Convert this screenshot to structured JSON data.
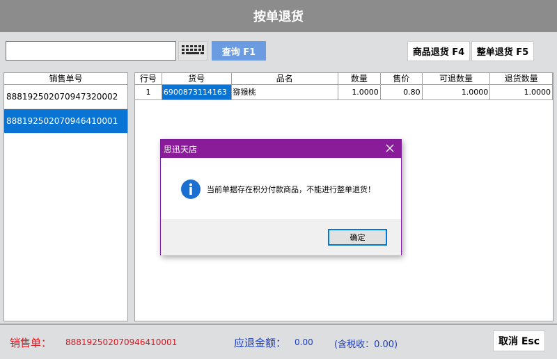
{
  "title": "按单退货",
  "search": {
    "value": "",
    "query_label": "查询 F1"
  },
  "toolbar": {
    "item_return_label": "商品退货 F4",
    "order_return_label": "整单退货 F5"
  },
  "orders": {
    "header": "销售单号",
    "items": [
      "888192502070947320002",
      "888192502070946410001"
    ],
    "selected_index": 1
  },
  "grid": {
    "headers": [
      "行号",
      "货号",
      "品名",
      "数量",
      "售价",
      "可退数量",
      "退货数量"
    ],
    "rows": [
      [
        "1",
        "6900873114163",
        "猕猴桃",
        "1.0000",
        "0.80",
        "1.0000",
        "1.0000"
      ]
    ]
  },
  "footer": {
    "order_label": "销售单：",
    "order_value": "888192502070946410001",
    "refund_label": "应退金额：",
    "refund_value": "0.00",
    "tax_text": "(含税收：0.00)",
    "cancel_label": "取消 Esc"
  },
  "dialog": {
    "title": "思迅天店",
    "message": "当前单据存在积分付款商品，不能进行整单退货！",
    "ok_label": "确定"
  },
  "colors": {
    "selection": "#0a74d4",
    "dialog_title": "#8a1c9a",
    "footer_red": "#e0141e",
    "footer_blue": "#1c3cc8",
    "query_button": "#6b9be0"
  }
}
